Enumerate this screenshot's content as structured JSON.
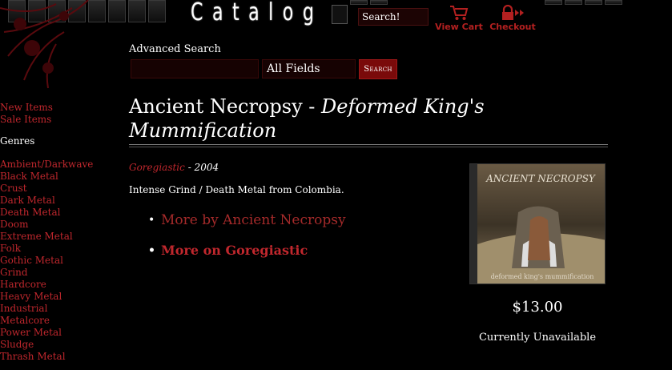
{
  "header": {
    "catalog_title": "Catalog",
    "search_placeholder": "Search!",
    "cart_label": "View Cart",
    "checkout_label": "Checkout"
  },
  "advanced_search": {
    "label": "Advanced Search",
    "query_value": "",
    "field_selected": "All Fields",
    "button_label": "Search"
  },
  "sidebar": {
    "top_links": [
      "New Items",
      "Sale Items"
    ],
    "genres_heading": "Genres",
    "genres": [
      "Ambient/Darkwave",
      "Black Metal",
      "Crust",
      "Dark Metal",
      "Death Metal",
      "Doom",
      "Extreme Metal",
      "Folk",
      "Gothic Metal",
      "Grind",
      "Hardcore",
      "Heavy Metal",
      "Industrial",
      "Metalcore",
      "Power Metal",
      "Sludge",
      "Thrash Metal"
    ]
  },
  "product": {
    "artist": "Ancient Necropsy",
    "separator": " - ",
    "album": "Deformed King's Mummification",
    "label": "Goregiastic",
    "year_text": " - 2004",
    "description": "Intense Grind / Death Metal from Colombia.",
    "related_links": [
      "More by Ancient Necropsy",
      "More on Goregiastic"
    ],
    "price": "$13.00",
    "availability": "Currently Unavailable",
    "cover_band_text": "ANCIENT NECROPSY",
    "cover_album_text": "deformed king's mummification"
  },
  "colors": {
    "background": "#000000",
    "link_red": "#c0272d",
    "button_red": "#7a0a0a",
    "text": "#ffffff"
  },
  "icons": {
    "cart": "shopping-cart-icon",
    "checkout": "lock-icon"
  }
}
